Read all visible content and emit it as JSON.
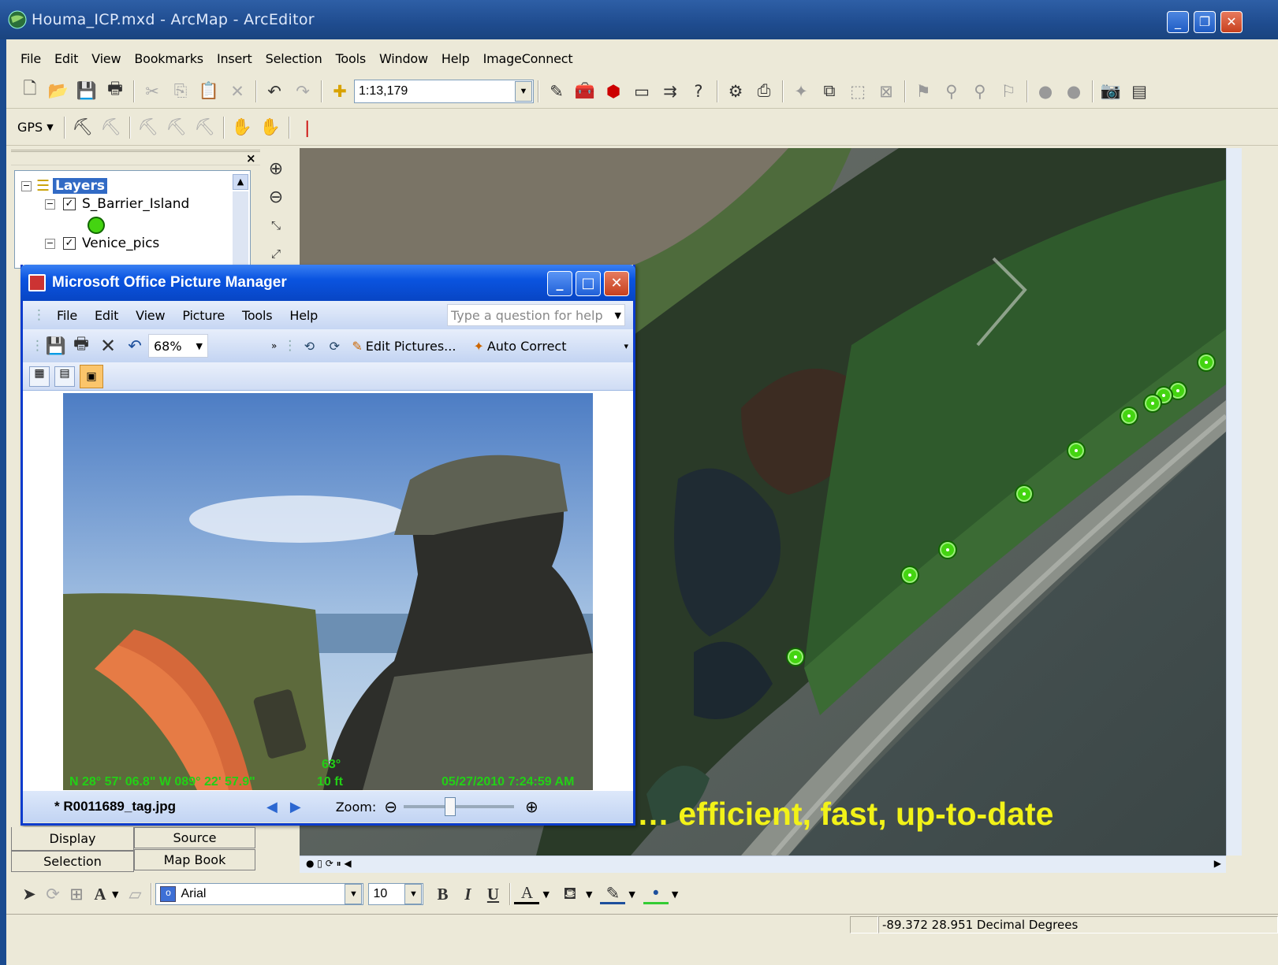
{
  "window": {
    "title": "Houma_ICP.mxd - ArcMap - ArcEditor"
  },
  "menu": [
    "File",
    "Edit",
    "View",
    "Bookmarks",
    "Insert",
    "Selection",
    "Tools",
    "Window",
    "Help",
    "ImageConnect"
  ],
  "toolbar": {
    "scale": "1:13,179",
    "gps_label": "GPS"
  },
  "toc": {
    "root": "Layers",
    "layers": [
      {
        "name": "S_Barrier_Island",
        "checked": true
      },
      {
        "name": "Venice_pics",
        "checked": true
      }
    ],
    "tabs": [
      "Display",
      "Source",
      "Selection",
      "Map Book"
    ]
  },
  "picture_manager": {
    "title": "Microsoft Office Picture Manager",
    "menu": [
      "File",
      "Edit",
      "View",
      "Picture",
      "Tools",
      "Help"
    ],
    "help_placeholder": "Type a question for help",
    "zoom": "68%",
    "edit_pictures": "Edit Pictures...",
    "auto_correct": "Auto Correct",
    "photo_overlay": {
      "coords": "N 28° 57' 06.8\" W 089° 22' 57.9\"",
      "heading": "63°",
      "elevation": "10 ft",
      "datetime": "05/27/2010 7:24:59 AM"
    },
    "filename": "* R0011689_tag.jpg",
    "zoom_label": "Zoom:"
  },
  "map": {
    "caption": "… efficient, fast, up-to-date"
  },
  "drawing": {
    "font": "Arial",
    "size": "10"
  },
  "status": {
    "coords": "-89.372  28.951 Decimal Degrees"
  },
  "colors": {
    "title_blue": "#1f4c8f",
    "xp_blue": "#0a54e0",
    "point_green": "#44d411",
    "caption_yellow": "#f2f218"
  }
}
